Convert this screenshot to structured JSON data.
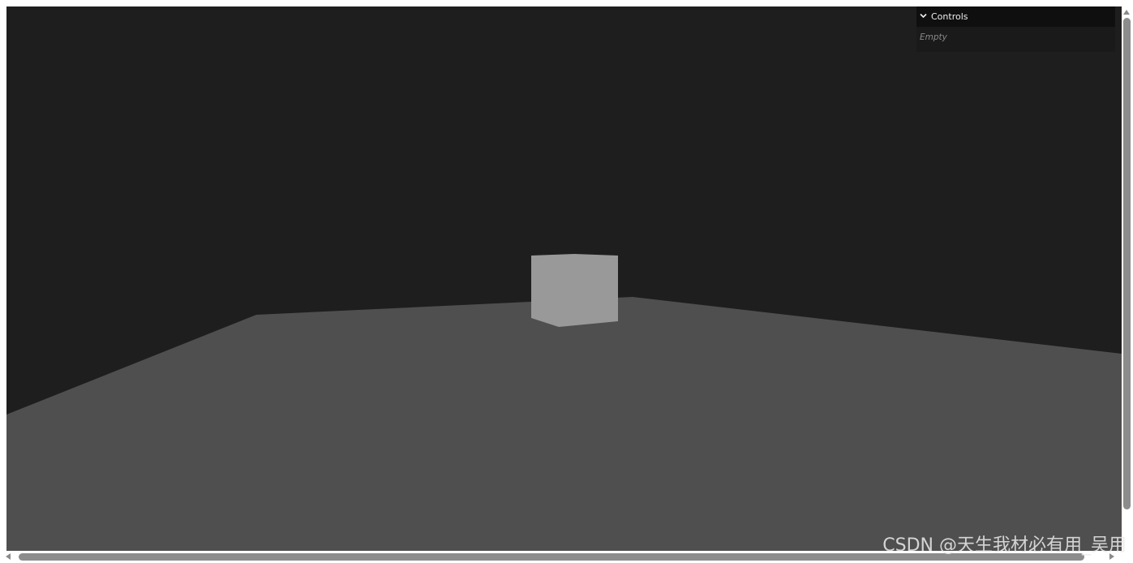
{
  "gui": {
    "title": "Controls",
    "empty_text": "Empty"
  },
  "watermark": {
    "text": "CSDN @天生我材必有用_吴用"
  },
  "colors": {
    "background": "#1e1e1e",
    "floor": "#4f4f4f",
    "cube": "#999999",
    "panel": "#1a1a1a",
    "panel_header": "#0f0f0f"
  },
  "icons": {
    "gui_toggle": "chevron-down-icon"
  }
}
